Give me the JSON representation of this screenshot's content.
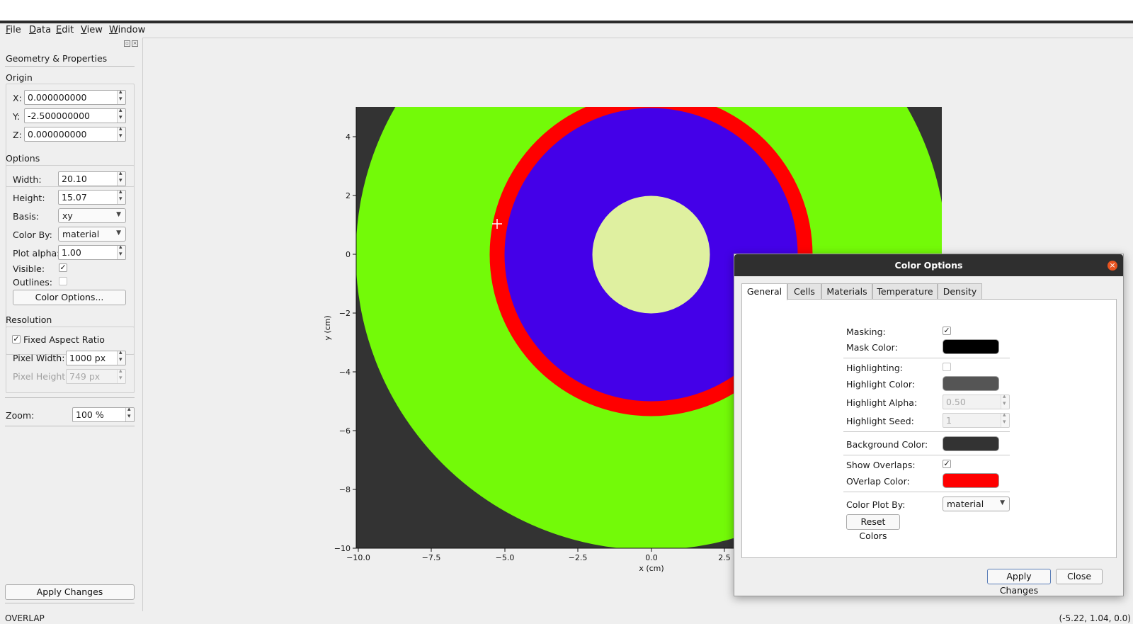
{
  "menu": [
    "File",
    "Data",
    "Edit",
    "View",
    "Window"
  ],
  "dock": {
    "title": "Geometry & Properties",
    "origin": {
      "label": "Origin",
      "x_label": "X:",
      "x": "0.000000000",
      "y_label": "Y:",
      "y": "-2.500000000",
      "z_label": "Z:",
      "z": "0.000000000"
    },
    "options": {
      "label": "Options",
      "width_label": "Width:",
      "width": "20.10",
      "height_label": "Height:",
      "height": "15.07",
      "basis_label": "Basis:",
      "basis": "xy",
      "colorby_label": "Color By:",
      "colorby": "material",
      "alpha_label": "Plot alpha:",
      "alpha": "1.00",
      "visible_label": "Visible:",
      "visible": true,
      "outlines_label": "Outlines:",
      "outlines": false,
      "color_options_button": "Color Options..."
    },
    "resolution": {
      "label": "Resolution",
      "fixed_aspect_label": "Fixed Aspect Ratio",
      "fixed_aspect": true,
      "pixel_width_label": "Pixel Width:",
      "pixel_width": "1000 px",
      "pixel_height_label": "Pixel Height:",
      "pixel_height": "749 px"
    },
    "zoom_label": "Zoom:",
    "zoom": "100 %",
    "apply_button": "Apply Changes"
  },
  "plot": {
    "xlabel": "x (cm)",
    "ylabel": "y (cm)",
    "xticks": [
      "−10.0",
      "−7.5",
      "−5.0",
      "−2.5",
      "0.0",
      "2.5"
    ],
    "yticks": [
      "4",
      "2",
      "0",
      "−2",
      "−4",
      "−6",
      "−8",
      "−10"
    ],
    "colors": {
      "background": "#333333",
      "outer_material": "#73fa08",
      "overlap": "#ff0000",
      "middle_material": "#4400e8",
      "inner_material": "#dff0a0"
    }
  },
  "status": {
    "left": "OVERLAP",
    "right": "(-5.22, 1.04, 0.0)"
  },
  "dialog": {
    "title": "Color Options",
    "tabs": [
      "General",
      "Cells",
      "Materials",
      "Temperature",
      "Density"
    ],
    "masking_label": "Masking:",
    "masking": true,
    "mask_color_label": "Mask Color:",
    "mask_color": "#000000",
    "highlighting_label": "Highlighting:",
    "highlighting": false,
    "highlight_color_label": "Highlight Color:",
    "highlight_color": "#555555",
    "highlight_alpha_label": "Highlight Alpha:",
    "highlight_alpha": "0.50",
    "highlight_seed_label": "Highlight Seed:",
    "highlight_seed": "1",
    "background_color_label": "Background Color:",
    "background_color": "#333333",
    "show_overlaps_label": "Show Overlaps:",
    "show_overlaps": true,
    "overlap_color_label": "OVerlap Color:",
    "overlap_color": "#ff0000",
    "color_plot_by_label": "Color Plot By:",
    "color_plot_by": "material",
    "reset_button": "Reset Colors",
    "apply_button": "Apply Changes",
    "close_button": "Close"
  }
}
